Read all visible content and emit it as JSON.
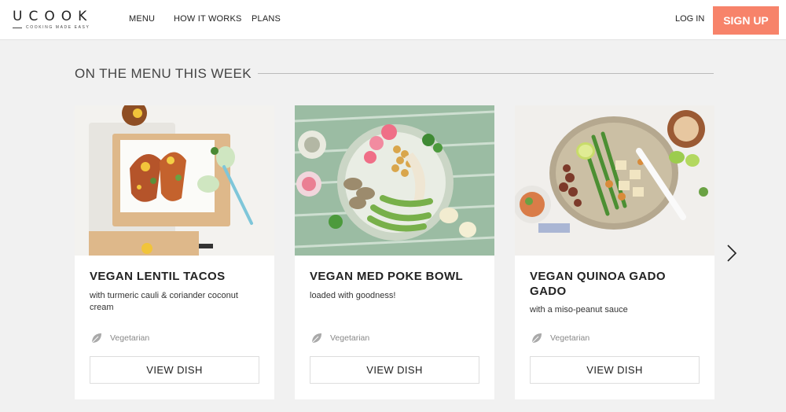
{
  "header": {
    "logo": "UCOOK",
    "logo_tagline": "COOKING MADE EASY",
    "nav": [
      "MENU",
      "HOW IT WORKS",
      "PLANS"
    ],
    "login_label": "LOG IN",
    "signup_label": "SIGN UP"
  },
  "section": {
    "title": "ON THE MENU THIS WEEK"
  },
  "dishes": [
    {
      "title": "VEGAN LENTIL TACOS",
      "subtitle": "with turmeric cauli & coriander coconut cream",
      "diet": "Vegetarian",
      "button": "VIEW DISH"
    },
    {
      "title": "VEGAN MED POKE BOWL",
      "subtitle": "loaded with goodness!",
      "diet": "Vegetarian",
      "button": "VIEW DISH"
    },
    {
      "title": "VEGAN QUINOA GADO GADO",
      "subtitle": "with a miso-peanut sauce",
      "diet": "Vegetarian",
      "button": "VIEW DISH"
    }
  ],
  "colors": {
    "accent": "#f7836a",
    "background": "#f1f1f1"
  },
  "icons": {
    "next": "chevron-right-icon",
    "diet": "leaf-icon"
  }
}
